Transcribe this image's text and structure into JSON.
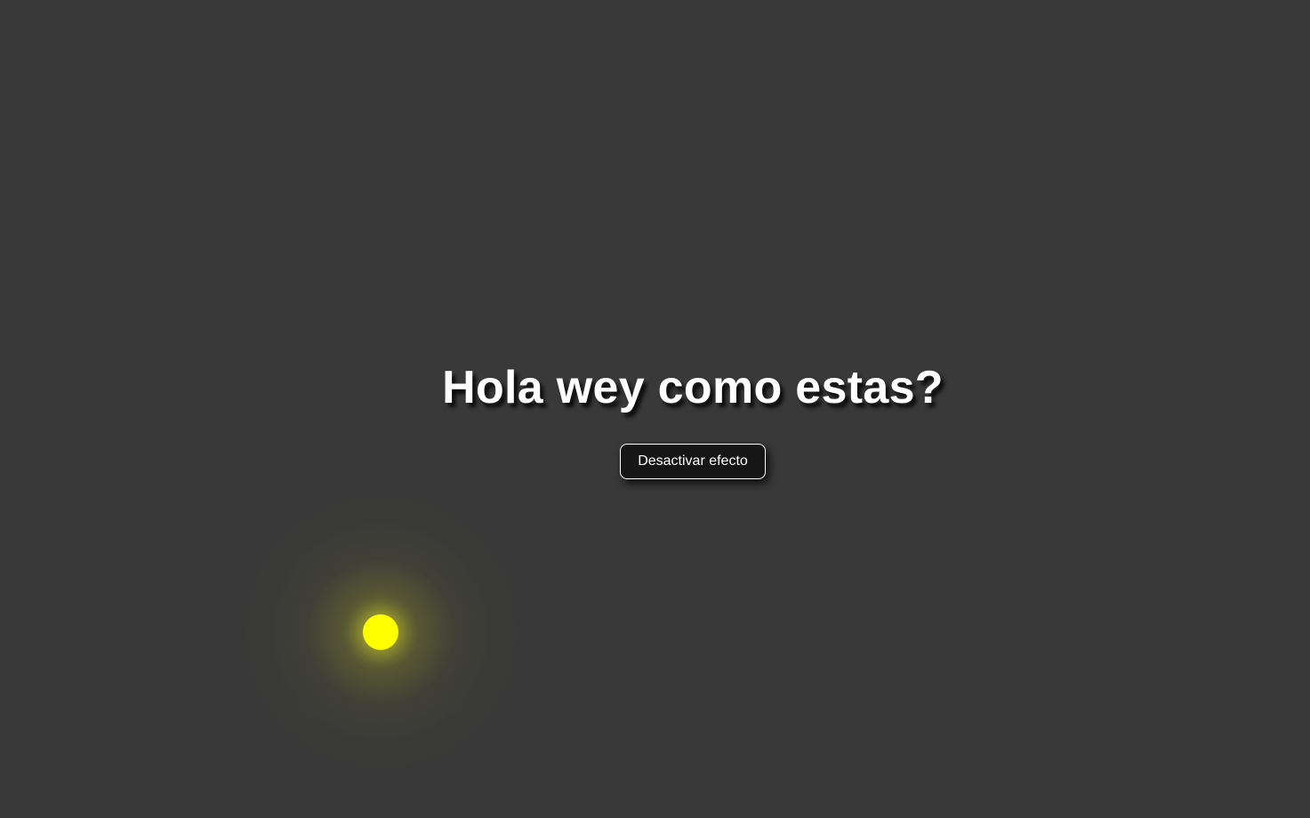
{
  "main": {
    "title": "Hola wey como estas?",
    "toggle_button_label": "Desactivar efecto"
  },
  "colors": {
    "background": "#393939",
    "text": "#ffffff",
    "button_background": "#161616",
    "light_orb": "#ffff00"
  },
  "icons": {
    "light_orb": "yellow-light-orb-icon"
  }
}
